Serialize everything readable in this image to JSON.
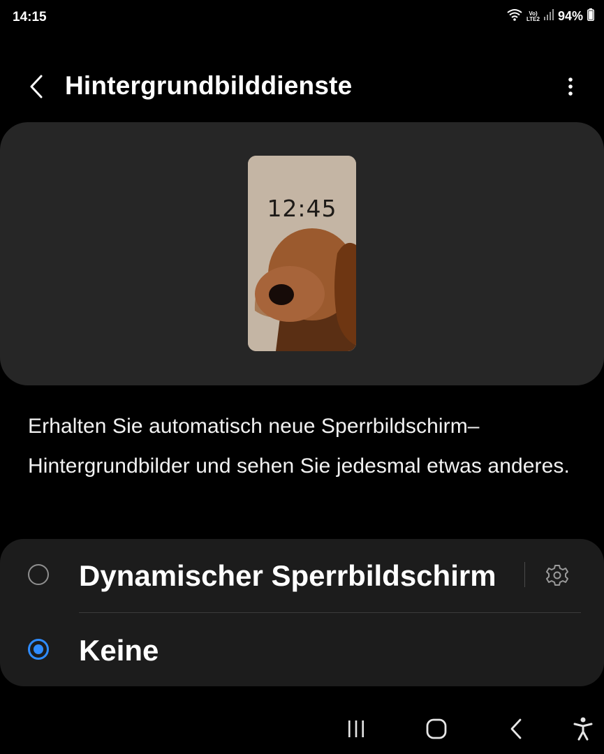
{
  "status_bar": {
    "time": "14:15",
    "network_top": "Vo)",
    "network_bottom": "LTE2",
    "battery_percent": "94%",
    "icons": [
      "wifi-icon",
      "volte-lte-icon",
      "signal-icon",
      "battery-icon"
    ]
  },
  "header": {
    "title": "Hintergrundbilddienste",
    "back_icon": "chevron-left-icon",
    "more_icon": "more-vertical-icon"
  },
  "preview": {
    "clock": "12:45",
    "image": "dog-wallpaper"
  },
  "description": "Erhalten Sie automatisch neue Sperrbildschirm–Hintergrundbilder und sehen Sie jedesmal etwas anderes.",
  "options": [
    {
      "label": "Dynamischer Sperrbildschirm",
      "selected": false,
      "settings_icon": "gear-icon"
    },
    {
      "label": "Keine",
      "selected": true
    }
  ],
  "colors": {
    "background": "#000000",
    "card": "#262626",
    "options_card": "#1c1c1c",
    "accent": "#2f8cff"
  },
  "nav_bar": {
    "icons": [
      "recents-icon",
      "home-icon",
      "back-icon",
      "accessibility-icon"
    ]
  }
}
